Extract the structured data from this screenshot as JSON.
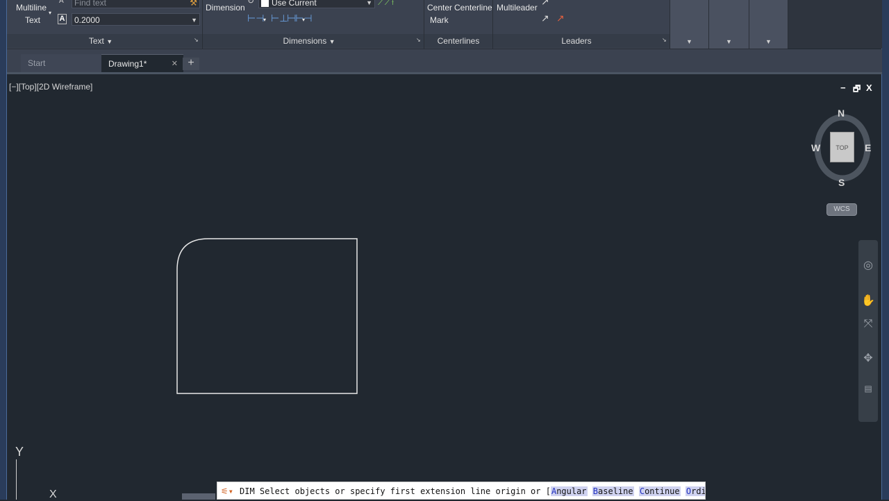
{
  "ribbon": {
    "text_panel": {
      "multiline_text_line1": "Multiline",
      "multiline_text_line2": "Text",
      "find_text_placeholder": "Find text",
      "height_value": "0.2000",
      "title": "Text"
    },
    "dimensions_panel": {
      "dimension_label": "Dimension",
      "layer_value": "Use Current",
      "title": "Dimensions"
    },
    "centerlines_panel": {
      "center_mark_line1": "Center",
      "center_mark_line2": "Mark",
      "centerline_label": "Centerline",
      "title": "Centerlines"
    },
    "leaders_panel": {
      "multileader_label": "Multileader",
      "title": "Leaders"
    }
  },
  "tabs": [
    {
      "label": "Start"
    },
    {
      "label": "Drawing1*"
    }
  ],
  "viewport": {
    "label": "[−][Top][2D Wireframe]",
    "controls": [
      "−",
      "🗗",
      "X"
    ]
  },
  "viewcube": {
    "north": "N",
    "south": "S",
    "east": "E",
    "west": "W",
    "face": "TOP",
    "wcs": "WCS"
  },
  "ucs": {
    "x": "X",
    "y": "Y"
  },
  "command_line": {
    "command": "DIM",
    "prompt": "Select objects or specify first extension line origin or [",
    "options": [
      {
        "key": "A",
        "rest": "ngular"
      },
      {
        "key": "B",
        "rest": "aseline"
      },
      {
        "key": "C",
        "rest": "ontinue"
      },
      {
        "key": "O",
        "rest": "rdinate"
      }
    ]
  },
  "colors": {
    "canvas": "#212830",
    "ribbon": "#3b4250",
    "geometry": "#e8e8e8",
    "frame": "#2a3c5a"
  }
}
